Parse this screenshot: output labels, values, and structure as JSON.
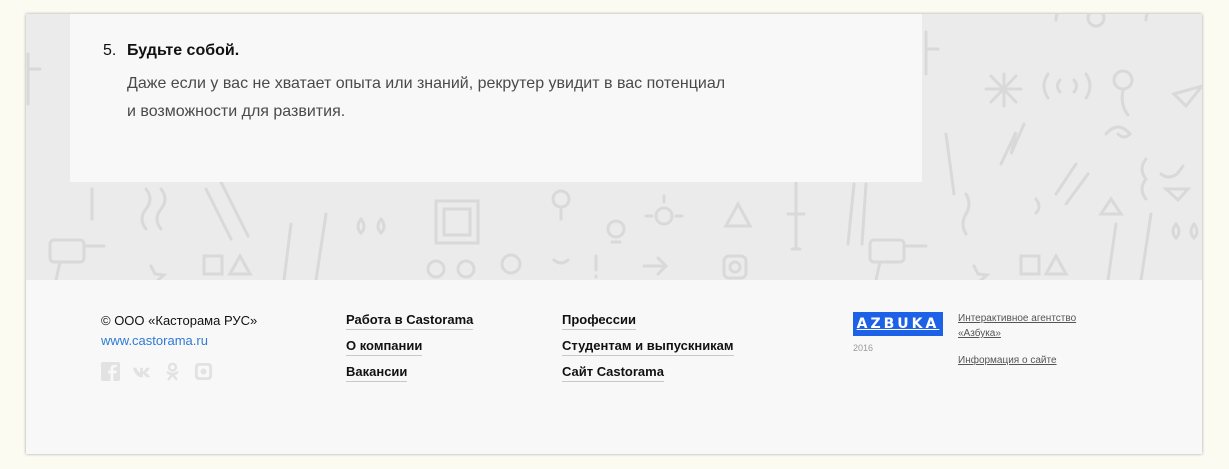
{
  "list_item": {
    "number": "5.",
    "title": "Будьте собой.",
    "line1": "Даже если у вас не хватает опыта или знаний, рекрутер увидит в вас потенциал",
    "line2": "и возможности для развития."
  },
  "footer": {
    "copyright": "© ООО «Касторама РУС»",
    "site": "www.castorama.ru",
    "socials": [
      "facebook-icon",
      "vk-icon",
      "odnoklassniki-icon",
      "instagram-icon"
    ],
    "menu1": [
      "Работа в Castorama",
      "О компании",
      "Вакансии"
    ],
    "menu2": [
      "Профессии",
      "Студентам и выпускникам",
      "Сайт Castorama"
    ],
    "logo": "AZBUKA",
    "year": "2016",
    "agency": "Интерактивное агентство «Азбука»",
    "info": "Информация о сайте",
    "colors": {
      "logo_bg": "#1d62e6",
      "link": "#2d7bd6"
    }
  }
}
